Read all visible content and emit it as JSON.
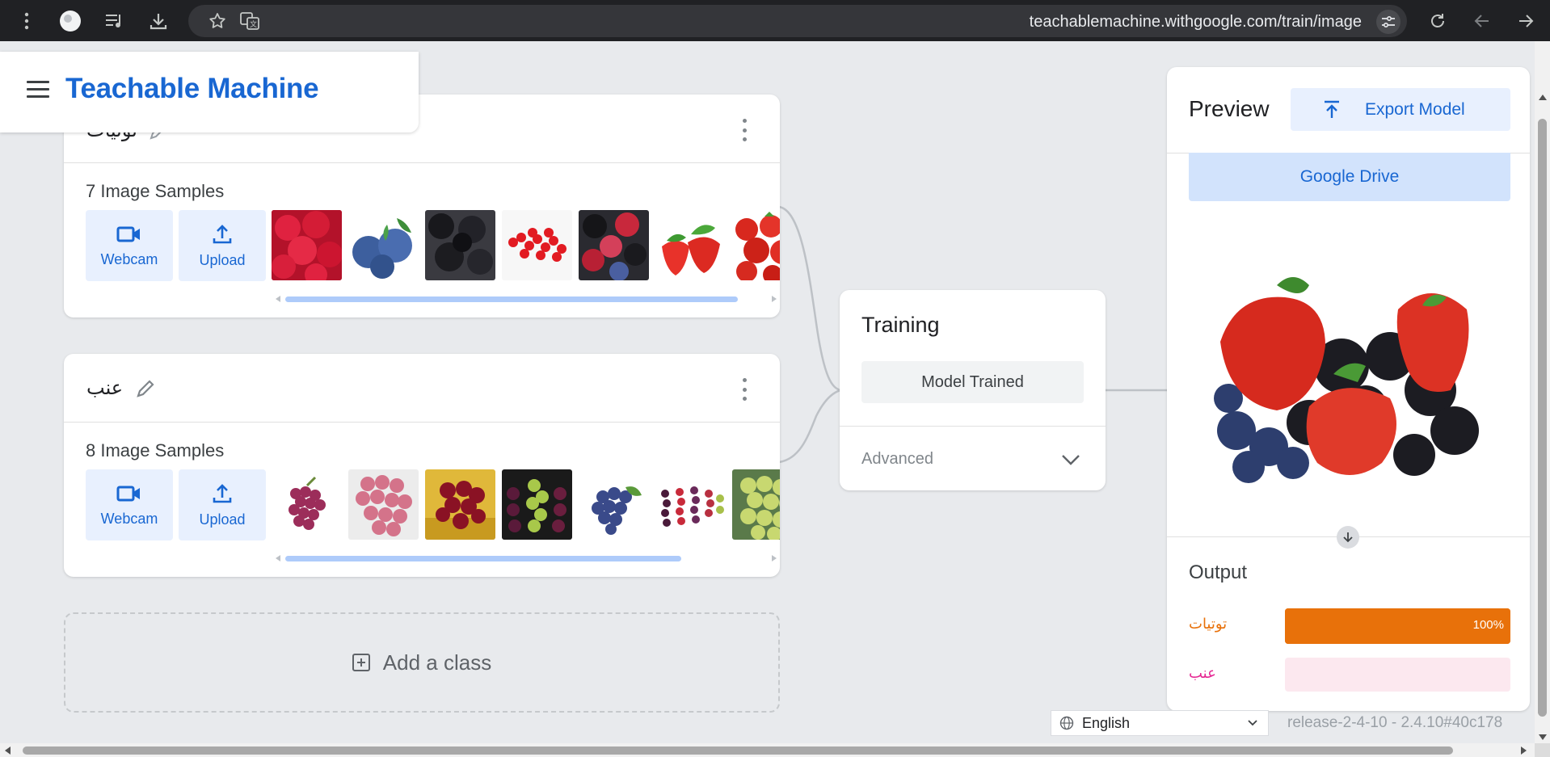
{
  "browser": {
    "url": "teachablemachine.withgoogle.com/train/image",
    "icons": [
      "more-vert-icon",
      "profile-icon",
      "media-icon",
      "download-icon",
      "star-icon",
      "translate-icon",
      "tune-icon",
      "reload-icon",
      "back-icon",
      "forward-icon"
    ]
  },
  "header": {
    "title": "Teachable Machine"
  },
  "classes": [
    {
      "name": "توتيات",
      "samples_label": "7 Image Samples",
      "webcam_label": "Webcam",
      "upload_label": "Upload",
      "thumbnails": [
        "raspberries",
        "blueberries",
        "blackberries",
        "redcurrants",
        "mixed-berries",
        "strawberries",
        "strawberries-pile"
      ]
    },
    {
      "name": "عنب",
      "samples_label": "8 Image Samples",
      "webcam_label": "Webcam",
      "upload_label": "Upload",
      "thumbnails": [
        "red-grapes",
        "pink-grapes",
        "red-grapes-plate",
        "mixed-grapes",
        "blue-grapes",
        "grape-varieties",
        "green-grapes"
      ]
    }
  ],
  "add_class": {
    "label": "Add a class"
  },
  "training": {
    "title": "Training",
    "status_button": "Model Trained",
    "advanced_label": "Advanced"
  },
  "preview": {
    "title": "Preview",
    "export_label": "Export Model",
    "drive_label": "Google Drive",
    "output_title": "Output",
    "outputs": [
      {
        "label": "توتيات",
        "value": 1.0,
        "pct_text": "100%",
        "color": "#e8710a",
        "track": "#e8710a"
      },
      {
        "label": "عنب",
        "value": 0.0,
        "pct_text": "",
        "color": "#e52592",
        "track": "#fce8ef"
      }
    ]
  },
  "footer": {
    "language": "English",
    "release": "release-2-4-10 - 2.4.10#40c178"
  },
  "colors": {
    "accent": "#1967d2",
    "button_bg": "#e8f0fe",
    "background": "#e8eaed"
  }
}
